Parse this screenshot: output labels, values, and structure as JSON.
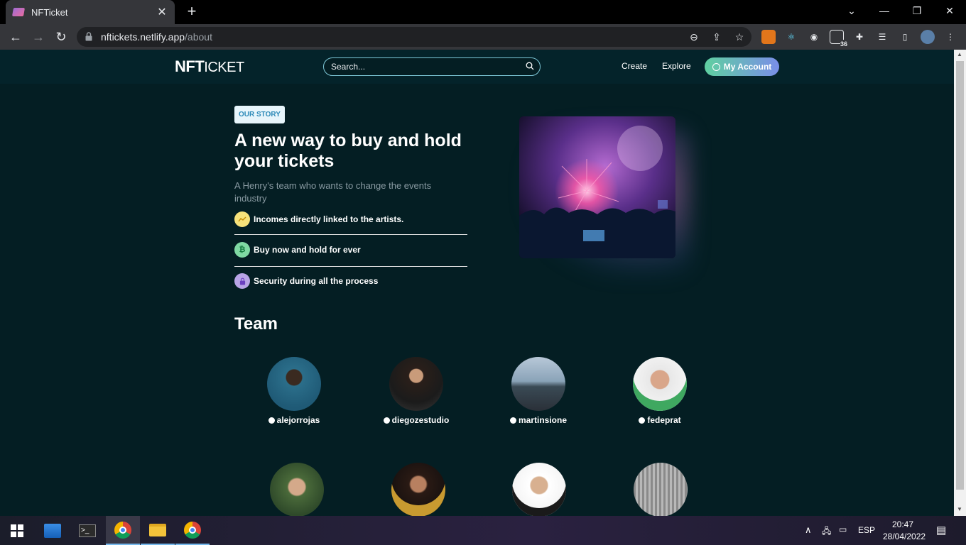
{
  "browser": {
    "tab_title": "NFTicket",
    "url_host": "nftickets.netlify.app",
    "url_path": "/about",
    "extension_badge": "36"
  },
  "site": {
    "logo_bold": "NFT",
    "logo_light": "ICKET",
    "search_placeholder": "Search...",
    "nav": {
      "create": "Create",
      "explore": "Explore",
      "account": "My Account"
    }
  },
  "story": {
    "badge": "OUR STORY",
    "headline": "A new way to buy and hold your tickets",
    "subheadline": "A Henry's team who wants to change the events industry",
    "features": [
      {
        "label": "Incomes directly linked to the artists.",
        "icon": "trend-up-icon",
        "color": "#f7e27a"
      },
      {
        "label": "Buy now and hold for ever",
        "icon": "bitcoin-icon",
        "color": "#7fd9a3"
      },
      {
        "label": "Security during all the process",
        "icon": "lock-icon",
        "color": "#b8a4e6"
      }
    ]
  },
  "team": {
    "title": "Team",
    "members": [
      {
        "handle": "alejorrojas"
      },
      {
        "handle": "diegozestudio"
      },
      {
        "handle": "martinsione"
      },
      {
        "handle": "fedeprat"
      },
      {
        "handle": ""
      },
      {
        "handle": ""
      },
      {
        "handle": ""
      },
      {
        "handle": ""
      }
    ]
  },
  "taskbar": {
    "language": "ESP",
    "time": "20:47",
    "date": "28/04/2022"
  },
  "colors": {
    "page_bg": "#041e23",
    "header_bg": "#04232a",
    "accent_gradient_start": "#5fd0a0",
    "accent_gradient_end": "#7a8ee8"
  }
}
